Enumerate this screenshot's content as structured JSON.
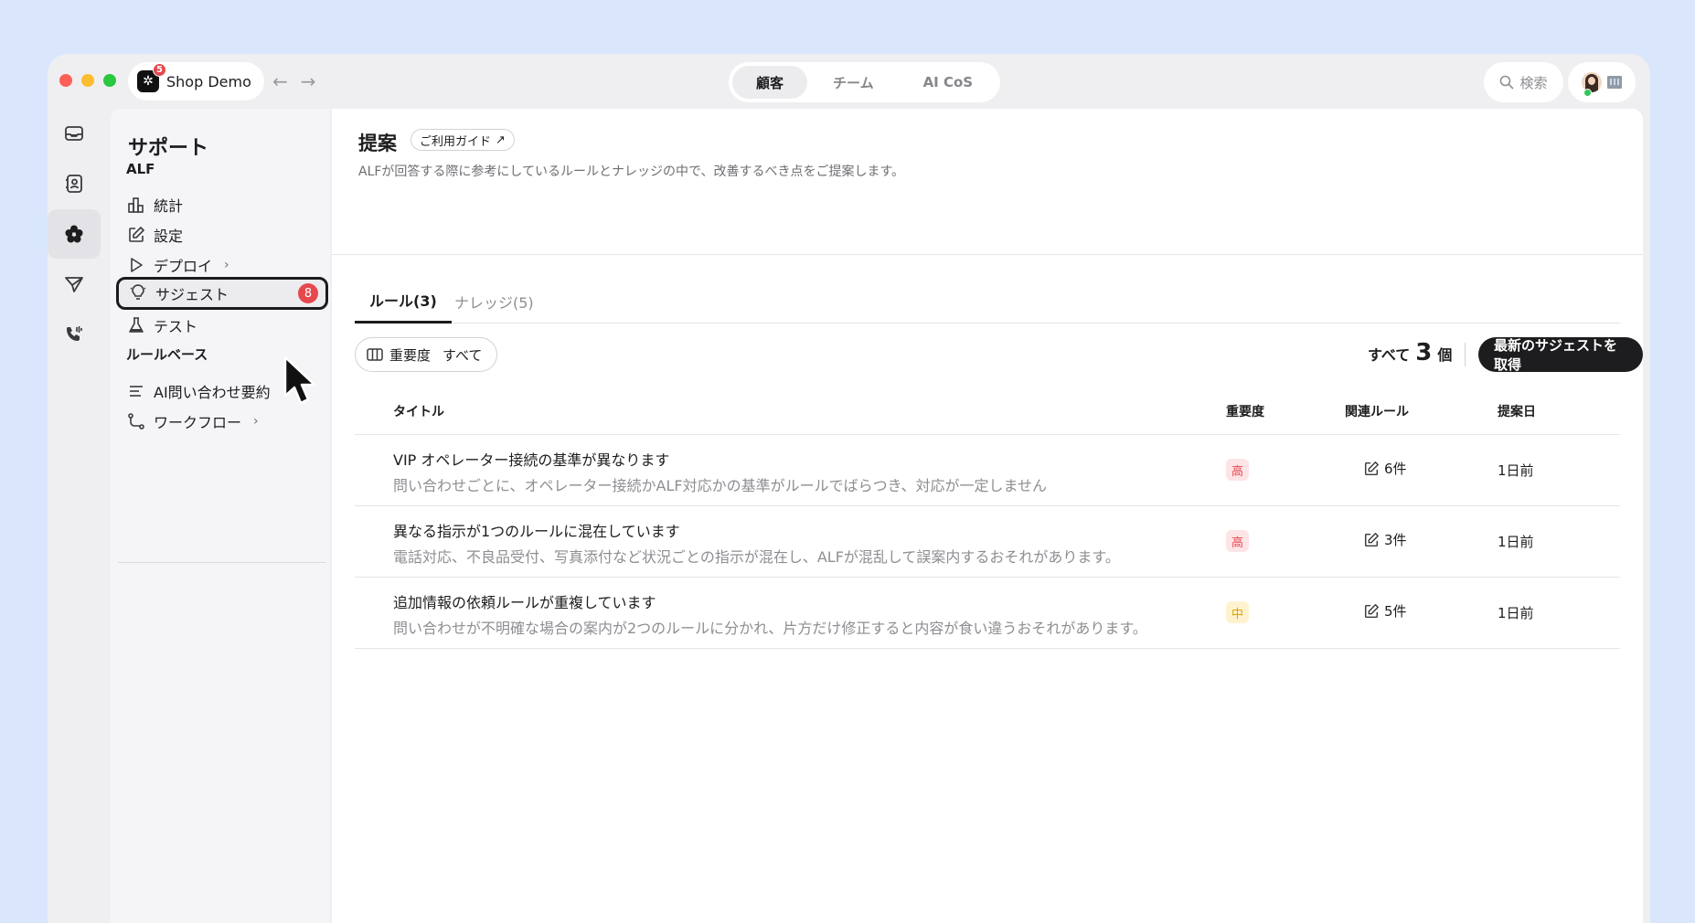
{
  "titlebar": {
    "app_name": "Shop Demo",
    "app_badge": "5",
    "segments": [
      {
        "label": "顧客",
        "active": true
      },
      {
        "label": "チーム",
        "active": false
      },
      {
        "label": "AI CoS",
        "active": false
      }
    ],
    "search_label": "検索"
  },
  "rail": {
    "icons": [
      "inbox-icon",
      "contact-icon",
      "flower-icon",
      "send-icon",
      "phone-icon"
    ],
    "active_index": 2
  },
  "sidebar": {
    "title": "サポート",
    "section_alf": "ALF",
    "items": [
      {
        "label": "統計",
        "icon": "bar-chart-icon"
      },
      {
        "label": "設定",
        "icon": "edit-icon"
      },
      {
        "label": "デプロイ",
        "icon": "play-icon",
        "chevron": "›"
      },
      {
        "label": "サジェスト",
        "icon": "bulb-icon",
        "badge": "8"
      },
      {
        "label": "テスト",
        "icon": "flask-icon"
      }
    ],
    "section_rulebase": "ルールベース",
    "items2": [
      {
        "label": "AI問い合わせ要約",
        "icon": "list-icon"
      },
      {
        "label": "ワークフロー",
        "icon": "workflow-icon",
        "chevron": "›"
      }
    ]
  },
  "main": {
    "title": "提案",
    "guide_label": "ご利用ガイド",
    "guide_icon": "↗",
    "description": "ALFが回答する際に参考にしているルールとナレッジの中で、改善するべき点をご提案します。",
    "tabs": [
      {
        "label": "ルール(3)",
        "active": true
      },
      {
        "label": "ナレッジ(5)",
        "active": false
      }
    ],
    "filter": {
      "label": "重要度",
      "value": "すべて"
    },
    "count": {
      "prefix": "すべて",
      "number": "3",
      "suffix": "個"
    },
    "fetch_label": "最新のサジェストを取得",
    "table": {
      "headers": [
        "タイトル",
        "重要度",
        "関連ルール",
        "提案日"
      ],
      "rows": [
        {
          "title": "VIP オペレーター接続の基準が異なります",
          "desc": "問い合わせごとに、オペレーター接続かALF対応かの基準がルールでばらつき、対応が一定しません",
          "severity": "高",
          "severity_level": "high",
          "related": "6件",
          "date": "1日前"
        },
        {
          "title": "異なる指示が1つのルールに混在しています",
          "desc": "電話対応、不良品受付、写真添付など状況ごとの指示が混在し、ALFが混乱して誤案内するおそれがあります。",
          "severity": "高",
          "severity_level": "high",
          "related": "3件",
          "date": "1日前"
        },
        {
          "title": "追加情報の依頼ルールが重複しています",
          "desc": "問い合わせが不明確な場合の案内が2つのルールに分かれ、片方だけ修正すると内容が食い違うおそれがあります。",
          "severity": "中",
          "severity_level": "mid",
          "related": "5件",
          "date": "1日前"
        }
      ]
    }
  },
  "colors": {
    "desktop_bg": "#d9e6fb",
    "badge_red": "#e5484d",
    "high_bg": "#fde4e6",
    "mid_bg": "#fff3cf",
    "button_dark": "#1d1d1f"
  }
}
